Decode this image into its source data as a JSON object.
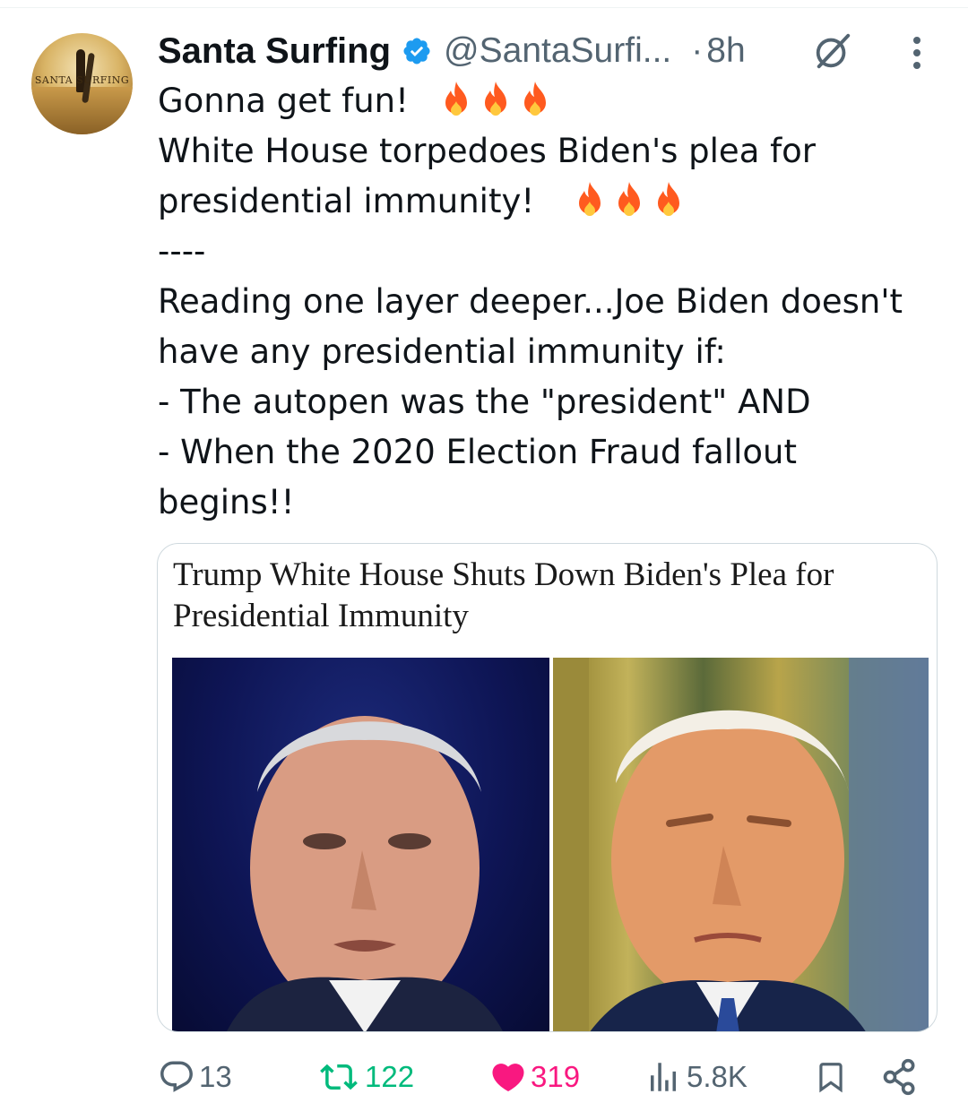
{
  "author": {
    "name": "Santa Surfing",
    "handle": "@SantaSurfi...",
    "time": "8h",
    "separator": "·",
    "avatar_text": "SANTA SURFING",
    "verified_color": "#1d9bf0"
  },
  "tweet": {
    "lines": [
      "Gonna get fun!",
      "White House torpedoes Biden's plea for",
      "presidential immunity!",
      "----",
      "Reading one layer deeper...Joe Biden doesn't",
      "have any presidential immunity if:",
      "- The autopen was the \"president\" AND",
      "- When the 2020 Election Fraud fallout",
      "begins!!"
    ]
  },
  "card": {
    "title_line1": "Trump White House Shuts Down Biden's Plea for",
    "title_line2": "Presidential Immunity"
  },
  "actions": {
    "replies": "13",
    "retweets": "122",
    "likes": "319",
    "views": "5.8K"
  },
  "colors": {
    "text": "#0f1419",
    "secondary": "#536471",
    "retweet": "#00ba7c",
    "like": "#f91880",
    "verified": "#1d9bf0"
  },
  "icons": [
    "verified-badge-icon",
    "grok-icon",
    "more-icon",
    "fire-icon",
    "reply-icon",
    "retweet-icon",
    "heart-icon",
    "views-icon",
    "bookmark-icon",
    "share-icon"
  ]
}
